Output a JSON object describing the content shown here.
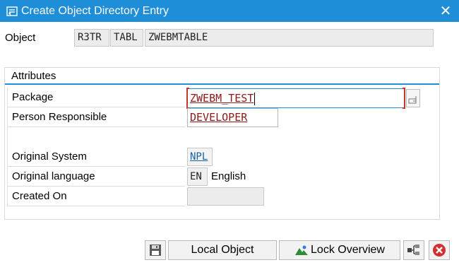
{
  "window": {
    "title": "Create Object Directory Entry",
    "close_icon": "close-icon"
  },
  "object": {
    "label": "Object",
    "pgmid": "R3TR",
    "type": "TABL",
    "name": "ZWEBMTABLE"
  },
  "attributes": {
    "header": "Attributes",
    "package_label": "Package",
    "package_value": "ZWEBM_TEST",
    "person_label": "Person Responsible",
    "person_value": "DEVELOPER",
    "orig_system_label": "Original System",
    "orig_system_value": "NPL",
    "orig_language_label": "Original language",
    "orig_language_code": "EN",
    "orig_language_name": "English",
    "created_on_label": "Created On",
    "created_on_value": ""
  },
  "toolbar": {
    "save_icon": "save-icon",
    "local_object_label": "Local Object",
    "lock_overview_label": "Lock Overview",
    "lock_overview_icon": "lock-overview-icon",
    "hierarchy_icon": "hierarchy-icon",
    "cancel_icon": "cancel-icon"
  },
  "colors": {
    "titlebar": "#1f8ed8",
    "required_bracket": "#c0392b",
    "input_text": "#8b1a1a",
    "cancel_red": "#d32f2f"
  }
}
